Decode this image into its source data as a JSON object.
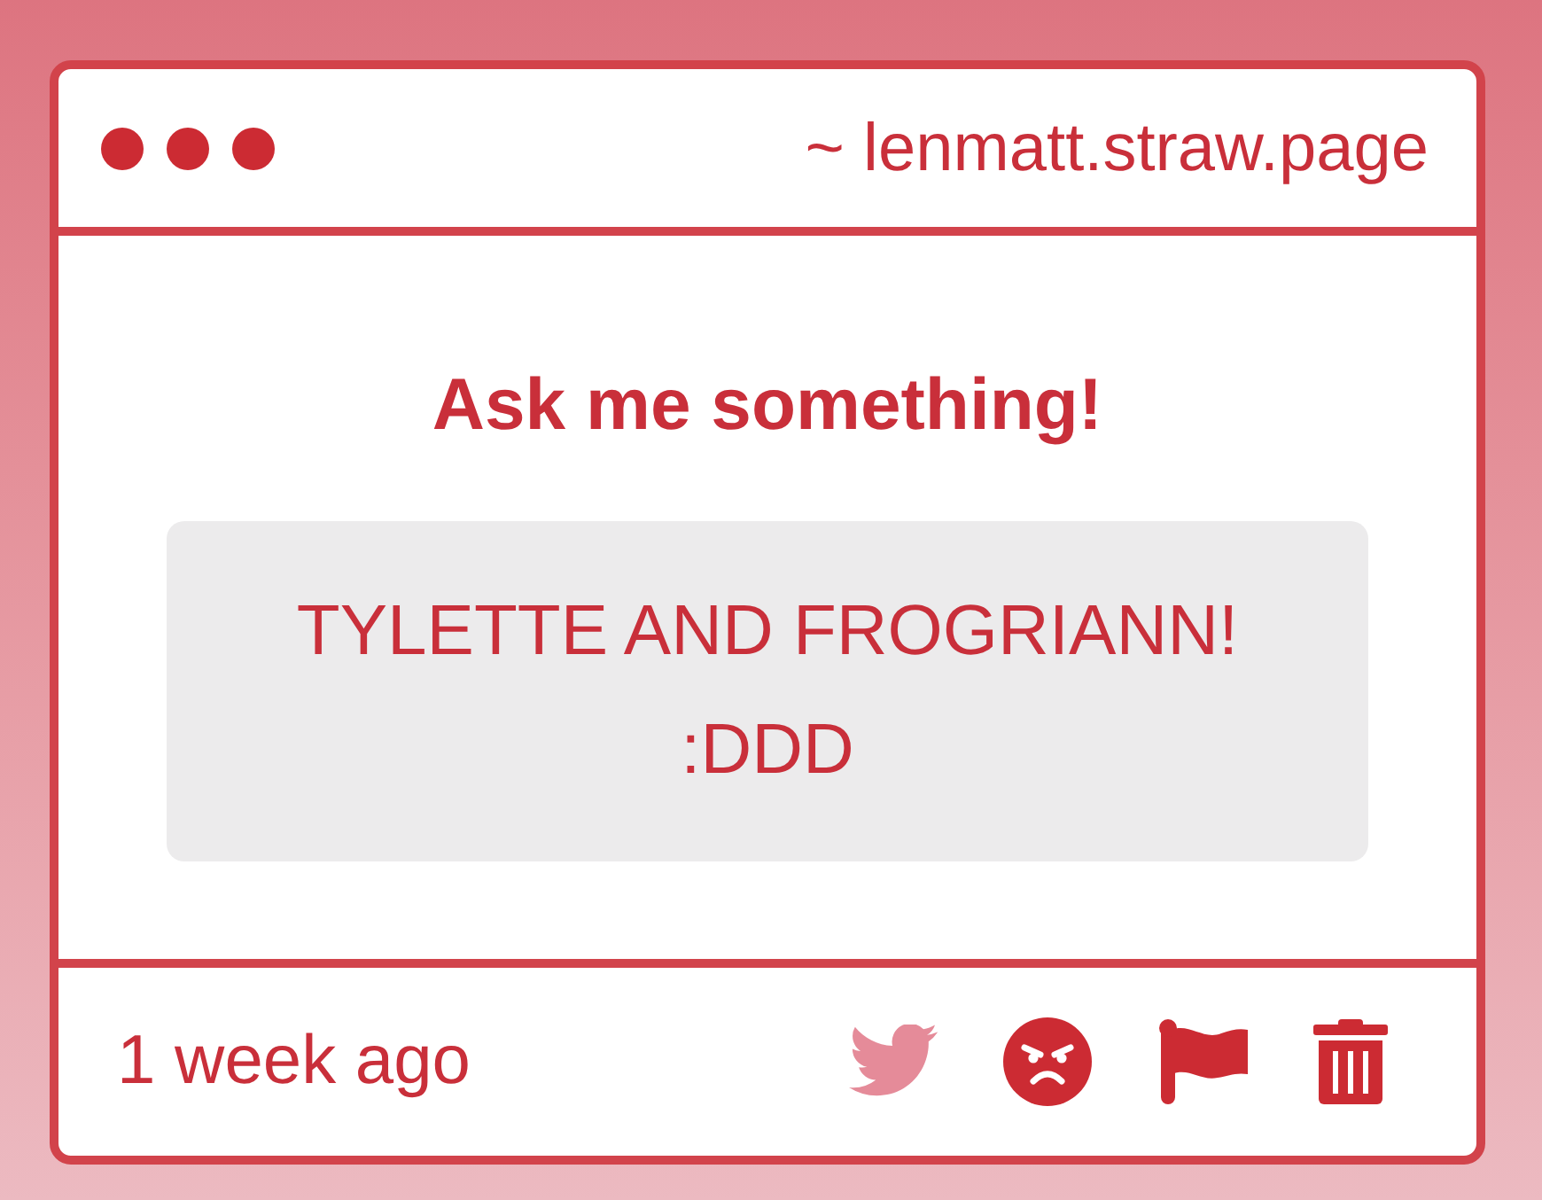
{
  "window": {
    "url": "~ lenmatt.straw.page"
  },
  "prompt": {
    "title": "Ask me something!"
  },
  "question": {
    "text": "TYLETTE AND FROGRIANN!\n:DDD"
  },
  "footer": {
    "time": "1 week ago",
    "actions": [
      {
        "kind": "share",
        "disabled": true
      },
      {
        "kind": "react",
        "disabled": false
      },
      {
        "kind": "flag",
        "disabled": false
      },
      {
        "kind": "delete",
        "disabled": false
      }
    ]
  }
}
